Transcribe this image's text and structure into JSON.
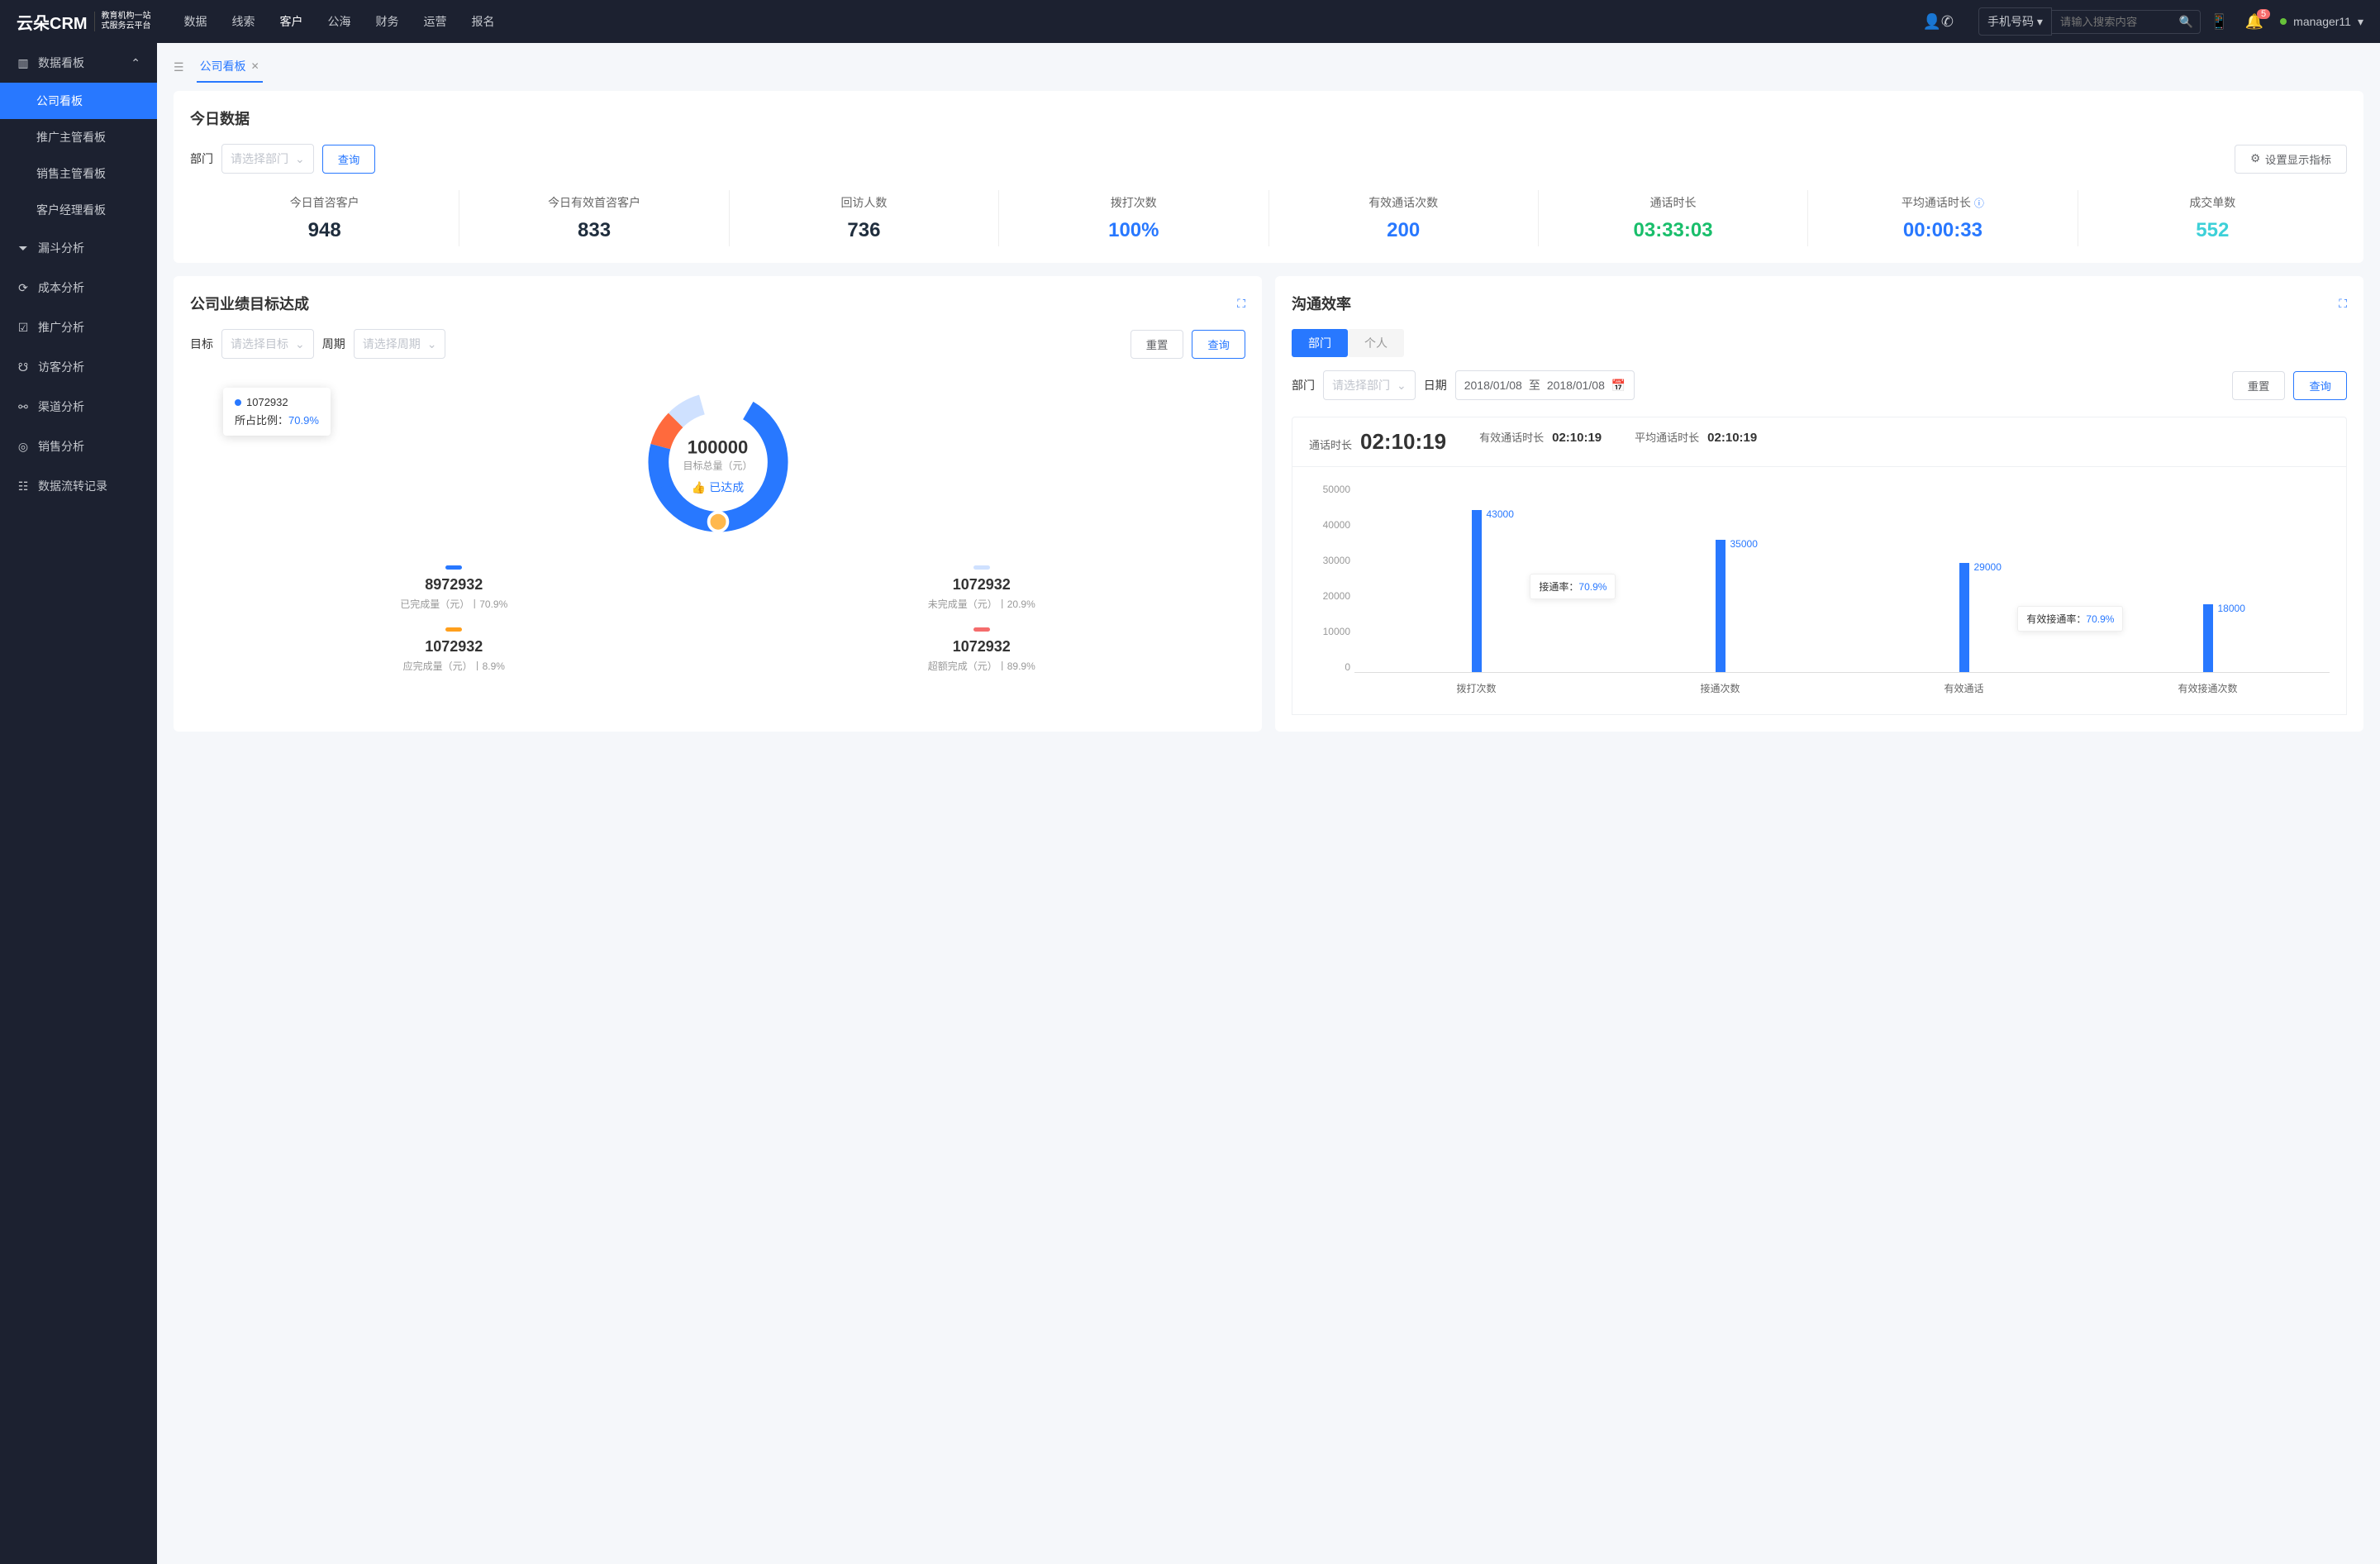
{
  "header": {
    "logo": "云朵CRM",
    "logo_sub1": "教育机构一站",
    "logo_sub2": "式服务云平台",
    "nav": [
      "数据",
      "线索",
      "客户",
      "公海",
      "财务",
      "运营",
      "报名"
    ],
    "nav_active_index": 2,
    "search_type": "手机号码",
    "search_placeholder": "请输入搜索内容",
    "notif_count": "5",
    "username": "manager11"
  },
  "sidebar": {
    "group": {
      "label": "数据看板"
    },
    "subs": [
      "公司看板",
      "推广主管看板",
      "销售主管看板",
      "客户经理看板"
    ],
    "sub_active_index": 0,
    "items": [
      {
        "icon": "funnel",
        "label": "漏斗分析"
      },
      {
        "icon": "clock",
        "label": "成本分析"
      },
      {
        "icon": "chart",
        "label": "推广分析"
      },
      {
        "icon": "person",
        "label": "访客分析"
      },
      {
        "icon": "channel",
        "label": "渠道分析"
      },
      {
        "icon": "target",
        "label": "销售分析"
      },
      {
        "icon": "list",
        "label": "数据流转记录"
      }
    ]
  },
  "tabs": {
    "tab_label": "公司看板"
  },
  "today": {
    "title": "今日数据",
    "dept_label": "部门",
    "dept_placeholder": "请选择部门",
    "query_btn": "查询",
    "settings_btn": "设置显示指标",
    "metrics": [
      {
        "label": "今日首咨客户",
        "value": "948",
        "color": "c-dark"
      },
      {
        "label": "今日有效首咨客户",
        "value": "833",
        "color": "c-dark"
      },
      {
        "label": "回访人数",
        "value": "736",
        "color": "c-dark"
      },
      {
        "label": "拨打次数",
        "value": "100%",
        "color": "c-blue"
      },
      {
        "label": "有效通话次数",
        "value": "200",
        "color": "c-blue"
      },
      {
        "label": "通话时长",
        "value": "03:33:03",
        "color": "c-green"
      },
      {
        "label": "平均通话时长",
        "value": "00:00:33",
        "color": "c-blue",
        "help": true
      },
      {
        "label": "成交单数",
        "value": "552",
        "color": "c-cyan"
      }
    ]
  },
  "goal": {
    "title": "公司业绩目标达成",
    "target_label": "目标",
    "target_placeholder": "请选择目标",
    "cycle_label": "周期",
    "cycle_placeholder": "请选择周期",
    "reset_btn": "重置",
    "query_btn": "查询",
    "center_value": "100000",
    "center_label": "目标总量（元）",
    "center_status": "已达成",
    "tooltip_value": "1072932",
    "tooltip_ratio_label": "所占比例：",
    "tooltip_ratio_value": "70.9%",
    "stats": [
      {
        "bar": "bar-blue",
        "value": "8972932",
        "desc": "已完成量（元）丨70.9%"
      },
      {
        "bar": "bar-lightblue",
        "value": "1072932",
        "desc": "未完成量（元）丨20.9%"
      },
      {
        "bar": "bar-orange",
        "value": "1072932",
        "desc": "应完成量（元）丨8.9%"
      },
      {
        "bar": "bar-red",
        "value": "1072932",
        "desc": "超额完成（元）丨89.9%"
      }
    ]
  },
  "efficiency": {
    "title": "沟通效率",
    "seg": [
      "部门",
      "个人"
    ],
    "seg_active_index": 0,
    "dept_label": "部门",
    "dept_placeholder": "请选择部门",
    "date_label": "日期",
    "date_from": "2018/01/08",
    "date_to_label": "至",
    "date_to": "2018/01/08",
    "reset_btn": "重置",
    "query_btn": "查询",
    "head": [
      {
        "label": "通话时长",
        "value": "02:10:19",
        "big": true
      },
      {
        "label": "有效通话时长",
        "value": "02:10:19"
      },
      {
        "label": "平均通话时长",
        "value": "02:10:19"
      }
    ],
    "annotations": [
      {
        "label": "接通率：",
        "value": "70.9%"
      },
      {
        "label": "有效接通率：",
        "value": "70.9%"
      }
    ]
  },
  "chart_data": [
    {
      "type": "donut",
      "title": "公司业绩目标达成",
      "center_value": 100000,
      "center_label": "目标总量（元）",
      "series": [
        {
          "name": "已完成",
          "value": 70.9,
          "color": "#2878ff"
        },
        {
          "name": "未完成",
          "value": 20.9,
          "color": "#cfe1ff"
        },
        {
          "name": "应完成",
          "value": 8.2,
          "color": "#ff6a3d"
        }
      ]
    },
    {
      "type": "bar",
      "title": "沟通效率",
      "categories": [
        "拨打次数",
        "接通次数",
        "有效通话",
        "有效接通次数"
      ],
      "values": [
        43000,
        35000,
        29000,
        18000
      ],
      "ylim": [
        0,
        50000
      ],
      "yticks": [
        0,
        10000,
        20000,
        30000,
        40000,
        50000
      ],
      "annotations": [
        {
          "after_category_index": 1,
          "label": "接通率",
          "value": "70.9%"
        },
        {
          "after_category_index": 3,
          "label": "有效接通率",
          "value": "70.9%"
        }
      ],
      "xlabel": "",
      "ylabel": ""
    }
  ]
}
